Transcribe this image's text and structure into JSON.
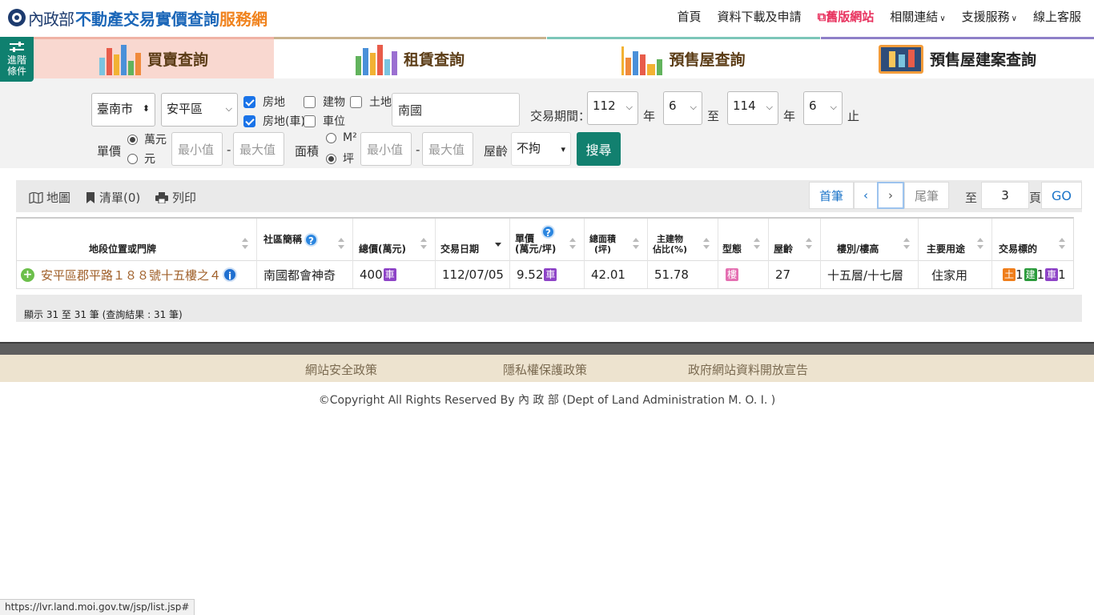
{
  "header": {
    "org": "內政部",
    "site_title_main": "不動產交易實價查詢",
    "site_title_accent": "服務網",
    "nav": {
      "home": "首頁",
      "download": "資料下載及申請",
      "old_site": "舊版網站",
      "links": "相關連結",
      "support": "支援服務",
      "online_service": "線上客服"
    }
  },
  "advanced": {
    "label_line1": "進階",
    "label_line2": "條件"
  },
  "tabs": [
    {
      "label": "買賣查詢"
    },
    {
      "label": "租賃查詢"
    },
    {
      "label": "預售屋查詢"
    },
    {
      "label": "預售屋建案查詢"
    }
  ],
  "search": {
    "city": "臺南市",
    "district": "安平區",
    "types": [
      {
        "label": "房地",
        "checked": true
      },
      {
        "label": "建物",
        "checked": false
      },
      {
        "label": "土地",
        "checked": false
      },
      {
        "label": "房地(車)",
        "checked": true
      },
      {
        "label": "車位",
        "checked": false
      }
    ],
    "keyword": "南國",
    "period_label": "交易期間：",
    "from_year": "112",
    "year_unit": "年",
    "from_month": "6",
    "to_label": "至",
    "to_year": "114",
    "to_month": "6",
    "end_label": "止",
    "unit_price_label": "單價",
    "price_units": [
      {
        "label": "萬元",
        "checked": true
      },
      {
        "label": "元",
        "checked": false
      }
    ],
    "min_placeholder": "最小值",
    "max_placeholder": "最大值",
    "dash": "-",
    "area_label": "面積",
    "area_units": [
      {
        "label": "M²",
        "checked": false
      },
      {
        "label": "坪",
        "checked": true
      }
    ],
    "age_label": "屋齡",
    "age_value": "不拘",
    "search_button": "搜尋"
  },
  "results_toolbar": {
    "map": "地圖",
    "list": "清單(0)",
    "print": "列印",
    "first": "首筆",
    "prev": "‹",
    "next": "›",
    "last": "尾筆",
    "to": "至",
    "page_value": "3",
    "page_unit": "頁",
    "go": "GO"
  },
  "table": {
    "columns": [
      "地段位置或門牌",
      "社區簡稱",
      "總價(萬元)",
      "交易日期",
      "單價\n(萬元/坪)",
      "總面積\n(坪)",
      "主建物\n佔比(%)",
      "型態",
      "屋齡",
      "樓別/樓高",
      "主要用途",
      "交易標的"
    ],
    "rows": [
      {
        "address": "安平區郡平路１８８號十五樓之４",
        "community": "南國都會神奇",
        "total_price": "400",
        "total_price_tag": "車",
        "date": "112/07/05",
        "unit_price": "9.52",
        "unit_price_tag": "車",
        "area": "42.01",
        "main_ratio": "51.78",
        "type_tag": "樓",
        "age": "27",
        "floor": "十五層/十七層",
        "usage": "住家用",
        "target": [
          {
            "tag": "土",
            "count": "1"
          },
          {
            "tag": "建",
            "count": "1"
          },
          {
            "tag": "車",
            "count": "1"
          }
        ]
      }
    ]
  },
  "summary": "顯示 31 至 31 筆 (查詢結果 : 31 筆)",
  "footer": {
    "links": [
      "網站安全政策",
      "隱私權保護政策",
      "政府網站資料開放宣告"
    ],
    "copyright": "©Copyright All Rights Reserved By 內 政 部 (Dept of Land Administration M. O. I. )"
  },
  "status_url": "https://lvr.land.moi.gov.tw/jsp/list.jsp#",
  "colors": {
    "brand_teal": "#0f806f",
    "title_blue": "#1a66b8",
    "title_orange": "#f0831e",
    "car_tag": "#8e44c7"
  }
}
